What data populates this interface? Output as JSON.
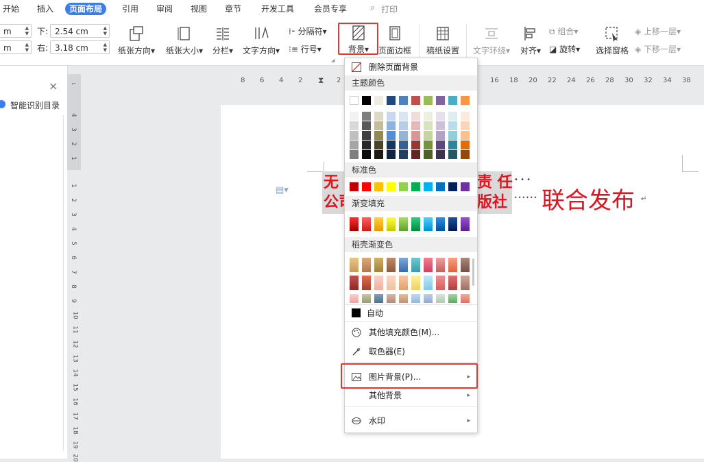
{
  "menubar": {
    "tabs": [
      "开始",
      "插入",
      "页面布局",
      "引用",
      "审阅",
      "视图",
      "章节",
      "开发工具",
      "会员专享"
    ],
    "active_tab": "页面布局",
    "print_label": "打印"
  },
  "ribbon": {
    "margins": {
      "top_value": "m",
      "bottom_label": "下:",
      "bottom_value": "2.54 cm",
      "left_value": "m",
      "right_label": "右:",
      "right_value": "3.18 cm"
    },
    "buttons": {
      "orientation": "纸张方向",
      "size": "纸张大小",
      "columns": "分栏",
      "text_direction": "文字方向",
      "breaks": "分隔符",
      "line_numbers": "行号",
      "background": "背景",
      "page_border": "页面边框",
      "page_setup": "稿纸设置",
      "wrap_text": "文字环绕",
      "align": "对齐",
      "group": "组合",
      "rotate": "旋转",
      "selection_pane": "选择窗格",
      "bring_forward": "上移一层",
      "send_backward": "下移一层"
    }
  },
  "left_pane": {
    "smart_toc": "智能识别目录",
    "close": "×"
  },
  "ruler": {
    "h_ticks": [
      "8",
      "6",
      "4",
      "2",
      "2",
      "16",
      "18",
      "20",
      "22",
      "24",
      "26",
      "28",
      "30",
      "32",
      "34",
      "38"
    ],
    "v_ticks": [
      "4",
      "3",
      "2",
      "1",
      "1",
      "2",
      "3",
      "4",
      "5",
      "6",
      "7",
      "8",
      "9",
      "10",
      "11",
      "12",
      "13",
      "14",
      "15",
      "16",
      "17",
      "18",
      "19",
      "20"
    ]
  },
  "document": {
    "line1_left": "无",
    "line2_left": "公司",
    "line1_right": "责 任",
    "line2_right": "版社",
    "dots1": "• • •",
    "dots2": "••••••",
    "big_text": "联合发布",
    "para_mark": "↵"
  },
  "dropdown": {
    "remove_bg": "删除页面背景",
    "theme_colors": "主题颜色",
    "standard_colors": "标准色",
    "gradient_fill": "渐变填充",
    "docer_gradient": "稻壳渐变色",
    "auto": "自动",
    "more_fill": "其他填充颜色(M)...",
    "eyedropper": "取色器(E)",
    "picture_bg": "图片背景(P)...",
    "other_bg": "其他背景",
    "watermark": "水印",
    "theme_top_row": [
      "#ffffff",
      "#000000",
      "#eeece1",
      "#1f497d",
      "#4f81bd",
      "#c0504d",
      "#9bbb59",
      "#8064a2",
      "#4bacc6",
      "#f79646"
    ],
    "theme_shades": [
      [
        "#f2f2f2",
        "#7f7f7f",
        "#ddd9c3",
        "#c6d9f0",
        "#dbe5f1",
        "#f2dcdb",
        "#ebf1dd",
        "#e5e0ec",
        "#dbeef3",
        "#fdeada"
      ],
      [
        "#d8d8d8",
        "#595959",
        "#c4bd97",
        "#8db3e2",
        "#b8cce4",
        "#e5b9b7",
        "#d7e3bc",
        "#ccc1d9",
        "#b7dde8",
        "#fbd5b5"
      ],
      [
        "#bfbfbf",
        "#3f3f3f",
        "#938953",
        "#548dd4",
        "#95b3d7",
        "#d99694",
        "#c3d69b",
        "#b2a2c7",
        "#92cddc",
        "#fac08f"
      ],
      [
        "#a5a5a5",
        "#262626",
        "#494429",
        "#17365d",
        "#366092",
        "#953734",
        "#76923c",
        "#5f497a",
        "#31859b",
        "#e36c09"
      ],
      [
        "#7f7f7f",
        "#0c0c0c",
        "#1d1b10",
        "#0f243e",
        "#244061",
        "#632423",
        "#4f6128",
        "#3f3151",
        "#205867",
        "#974806"
      ]
    ],
    "standard": [
      "#c00000",
      "#ff0000",
      "#ffc000",
      "#ffff00",
      "#92d050",
      "#00b050",
      "#00b0f0",
      "#0070c0",
      "#002060",
      "#7030a0"
    ],
    "gradients": [
      [
        "#a00000",
        "#ff3030"
      ],
      [
        "#d01818",
        "#ff6060"
      ],
      [
        "#e89a00",
        "#ffd040"
      ],
      [
        "#c8c800",
        "#ffff40"
      ],
      [
        "#5fa030",
        "#a8e060"
      ],
      [
        "#008a40",
        "#30d080"
      ],
      [
        "#0090d0",
        "#50d0ff"
      ],
      [
        "#0050a0",
        "#3090e0"
      ],
      [
        "#001850",
        "#2050a0"
      ],
      [
        "#5a1f90",
        "#9a50d0"
      ]
    ],
    "docer_rows": [
      [
        [
          "#c89a5a",
          "#e8c48a"
        ],
        [
          "#b07850",
          "#e0a878"
        ],
        [
          "#a08040",
          "#d0b060"
        ],
        [
          "#8a5a40",
          "#c08a6a"
        ],
        [
          "#3a6aa8",
          "#80a8d8"
        ],
        [
          "#3a9aa8",
          "#70c8d0"
        ],
        [
          "#d04060",
          "#f08090"
        ],
        [
          "#c06060",
          "#f0a0a0"
        ],
        [
          "#e06040",
          "#f8a080"
        ],
        [
          "#705048",
          "#b08878"
        ]
      ],
      [
        [
          "#902828",
          "#c05050"
        ],
        [
          "#a04030",
          "#e07050"
        ],
        [
          "#f0b0a0",
          "#fad0c8"
        ],
        [
          "#f0c0a0",
          "#fad8c0"
        ],
        [
          "#e0a070",
          "#f8c8a0"
        ],
        [
          "#f0d060",
          "#fff0a0"
        ],
        [
          "#80c8e8",
          "#c0e8f8"
        ],
        [
          "#d06060",
          "#f09090"
        ],
        [
          "#b04040",
          "#e07070"
        ],
        [
          "#a07060",
          "#d0a898"
        ]
      ],
      [
        [
          "#f0a0a0",
          "#fad0d0"
        ],
        [
          "#9a9a70",
          "#c8c8a0"
        ],
        [
          "#50708a",
          "#80a0b8"
        ],
        [
          "#b08878",
          "#d8b8a8"
        ],
        [
          "#c09070",
          "#e0c0a0"
        ],
        [
          "#90b8e0",
          "#c0d8f0"
        ],
        [
          "#90a8d0",
          "#c0d0e8"
        ],
        [
          "#b0c8b0",
          "#d8e8d8"
        ],
        [
          "#60a860",
          "#a0d8a0"
        ],
        [
          "#e07060",
          "#f8a898"
        ]
      ]
    ]
  }
}
